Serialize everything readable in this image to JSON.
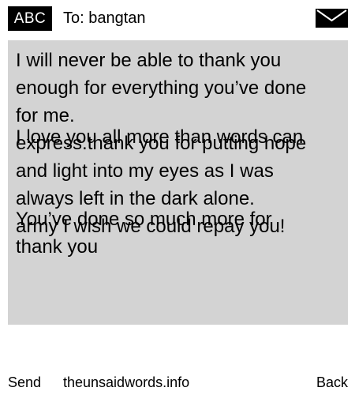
{
  "header": {
    "badge": "ABC",
    "to": "To: bangtan"
  },
  "message": {
    "background": "#d3d3d3",
    "lines": [
      "I will never be able to thank you",
      "enough for everything you’ve done",
      "for me.",
      "I love you all more than words can",
      "express.thank you for putting hope",
      "and light into my eyes as I was",
      "always left in the dark alone.",
      "You’ve done so much more for",
      "army I wish we could repay you!",
      "thank you"
    ]
  },
  "footer": {
    "send": "Send",
    "site": "theunsaidwords.info",
    "back": "Back"
  }
}
